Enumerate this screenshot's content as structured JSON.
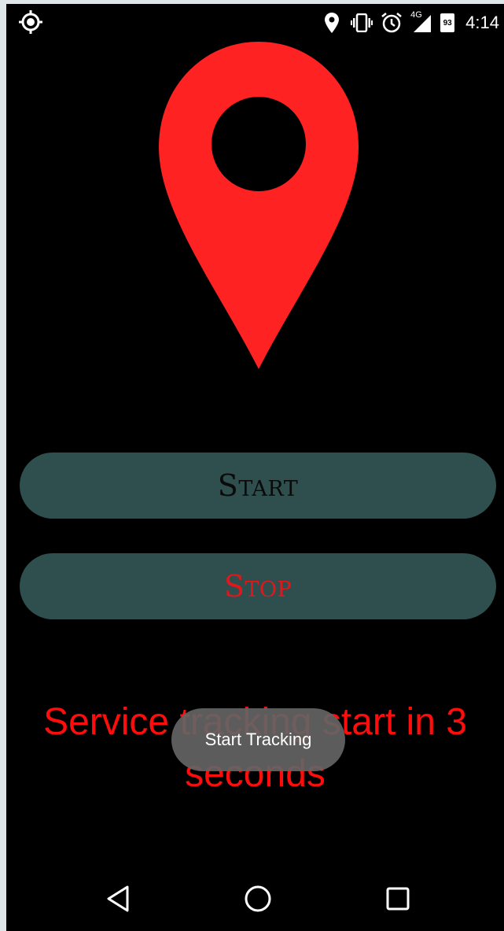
{
  "status_bar": {
    "time": "4:14",
    "network": "4G",
    "battery_level": "93",
    "icons": [
      "location-target-icon",
      "location-pin-icon",
      "vibrate-icon",
      "alarm-icon",
      "signal-icon",
      "battery-icon"
    ]
  },
  "main": {
    "start_label": "Start",
    "stop_label": "Stop",
    "message": "Service tracking start in 3 seconds"
  },
  "toast": {
    "text": "Start Tracking"
  },
  "colors": {
    "background": "#000000",
    "pin": "#ff2222",
    "button_bg": "#2f4f4f",
    "start_text": "#0a0a0a",
    "stop_text": "#e0171b",
    "message": "#ff0d0d",
    "toast_bg": "#646464"
  },
  "nav": {
    "icons": [
      "back-icon",
      "home-icon",
      "recents-icon"
    ]
  }
}
